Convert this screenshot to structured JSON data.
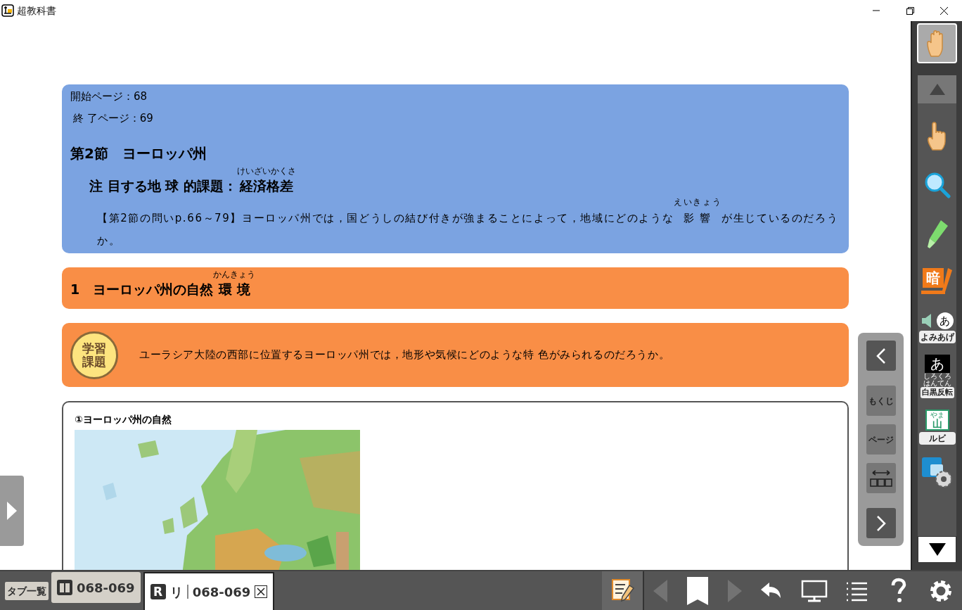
{
  "window": {
    "title": "超教科書"
  },
  "lesson": {
    "start_page": "開始ページ：68",
    "end_page": "終 了ページ：69",
    "section_title": "第2節　ヨーロッパ州",
    "focus": [
      {
        "text": "注 目する地 球 的課題："
      },
      {
        "text": "経済格差",
        "ruby": "けいざいかくさ"
      }
    ],
    "question": [
      {
        "text": "【第2節の問いp.66～79】ヨーロッパ州では，国どうしの結び付きが強まることによって，地域にどのような"
      },
      {
        "text": "影 響",
        "ruby": "えいきょう"
      },
      {
        "text": "が生じているのだろうか。"
      }
    ]
  },
  "topic_bar": [
    {
      "text": "1　ヨーロッパ州の自然"
    },
    {
      "text": "環 境",
      "ruby": "かんきょう"
    }
  ],
  "task": {
    "badge": "学習課題",
    "text": "ユーラシア大陸の西部に位置するヨーロッパ州では，地形や気候にどのような特 色がみられるのだろうか。"
  },
  "figure": {
    "caption": "①ヨーロッパ州の自然",
    "kind": "picture"
  },
  "page_nav": [
    "もくじ",
    "ページ"
  ],
  "tools": [
    {
      "kind": "pointer",
      "selected": false
    },
    {
      "kind": "magnifier",
      "selected": false
    },
    {
      "kind": "highlighter",
      "selected": false
    },
    {
      "kind": "memorize",
      "glyph": "暗",
      "selected": false
    },
    {
      "kind": "read_aloud",
      "glyph": "あ",
      "label": "よみあげ",
      "selected": false
    },
    {
      "kind": "invert",
      "glyph": "あ",
      "ruby": "しろくろはんてん",
      "label": "白黒反転",
      "selected": false
    },
    {
      "kind": "ruby",
      "glyph_ruby": "やま",
      "glyph": "山",
      "label": "ルビ",
      "selected": false
    },
    {
      "kind": "text_settings",
      "selected": false
    }
  ],
  "hand_tool": {
    "selected": true
  },
  "tabs": {
    "list_button": "タブ一覧",
    "items": [
      {
        "kind": "book",
        "label": "068-069",
        "selected": false
      },
      {
        "kind": "reader",
        "badge": "R",
        "prefix": "リ",
        "label": "068-069",
        "selected": true
      }
    ]
  },
  "bottom_tools": [
    {
      "kind": "notes",
      "disabled": false
    },
    {
      "kind": "prev",
      "disabled": true
    },
    {
      "kind": "bookmark",
      "disabled": false
    },
    {
      "kind": "next",
      "disabled": true
    },
    {
      "kind": "undo",
      "disabled": false
    },
    {
      "kind": "monitor",
      "disabled": false
    },
    {
      "kind": "list",
      "disabled": false
    },
    {
      "kind": "help",
      "disabled": false
    },
    {
      "kind": "settings",
      "disabled": false
    }
  ]
}
